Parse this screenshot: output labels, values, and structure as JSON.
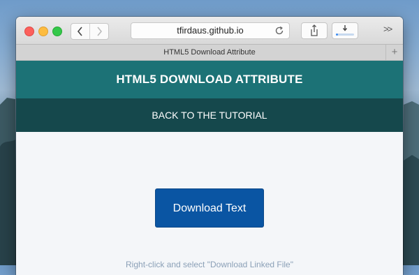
{
  "browser": {
    "address": "tfirdaus.github.io",
    "tab_title": "HTML5 Download Attribute",
    "new_tab_symbol": "+",
    "overflow_symbol": ">>",
    "download_progress": 0.1
  },
  "page": {
    "header_title": "HTML5 DOWNLOAD ATTRIBUTE",
    "nav_link": "BACK TO THE TUTORIAL",
    "download_button": "Download Text",
    "hint": "Right-click and select \"Download Linked File\""
  }
}
